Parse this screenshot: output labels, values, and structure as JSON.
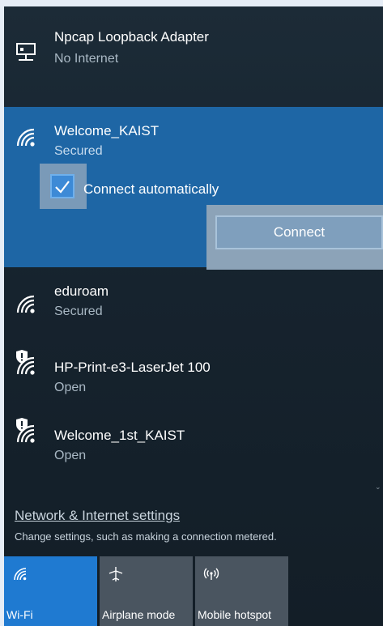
{
  "networks": [
    {
      "name": "Npcap Loopback Adapter",
      "status": "No Internet",
      "icon": "ethernet-icon"
    },
    {
      "name": "Welcome_KAIST",
      "status": "Secured",
      "icon": "wifi-icon"
    },
    {
      "name": "eduroam",
      "status": "Secured",
      "icon": "wifi-icon"
    },
    {
      "name": "HP-Print-e3-LaserJet 100",
      "status": "Open",
      "icon": "wifi-open-shield-icon"
    },
    {
      "name": "Welcome_1st_KAIST",
      "status": "Open",
      "icon": "wifi-open-shield-icon"
    }
  ],
  "selected": {
    "connect_automatically_label": "Connect automatically",
    "connect_automatically_checked": true,
    "connect_button": "Connect"
  },
  "settings": {
    "link": "Network & Internet settings",
    "description": "Change settings, such as making a connection metered."
  },
  "quick_actions": [
    {
      "label": "Wi-Fi",
      "icon": "wifi-icon",
      "active": true
    },
    {
      "label": "Airplane mode",
      "icon": "airplane-icon",
      "active": false
    },
    {
      "label": "Mobile hotspot",
      "icon": "hotspot-icon",
      "active": false
    }
  ],
  "colors": {
    "accent": "#1f7ad1",
    "selected_bg": "#1e66a5",
    "panel_bg": "#16232e"
  }
}
